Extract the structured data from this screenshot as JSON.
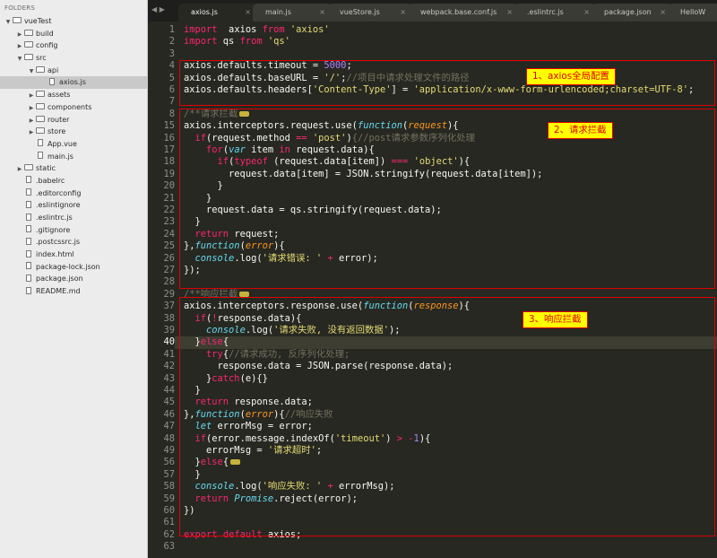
{
  "sidebar": {
    "title": "FOLDERS",
    "items": [
      {
        "name": "vueTest",
        "depth": 0,
        "type": "folder-open"
      },
      {
        "name": "build",
        "depth": 1,
        "type": "folder"
      },
      {
        "name": "config",
        "depth": 1,
        "type": "folder"
      },
      {
        "name": "src",
        "depth": 1,
        "type": "folder-open"
      },
      {
        "name": "api",
        "depth": 2,
        "type": "folder-open"
      },
      {
        "name": "axios.js",
        "depth": 3,
        "type": "file",
        "selected": true
      },
      {
        "name": "assets",
        "depth": 2,
        "type": "folder"
      },
      {
        "name": "components",
        "depth": 2,
        "type": "folder"
      },
      {
        "name": "router",
        "depth": 2,
        "type": "folder"
      },
      {
        "name": "store",
        "depth": 2,
        "type": "folder"
      },
      {
        "name": "App.vue",
        "depth": 2,
        "type": "file"
      },
      {
        "name": "main.js",
        "depth": 2,
        "type": "file"
      },
      {
        "name": "static",
        "depth": 1,
        "type": "folder"
      },
      {
        "name": ".babelrc",
        "depth": 1,
        "type": "file"
      },
      {
        "name": ".editorconfig",
        "depth": 1,
        "type": "file"
      },
      {
        "name": ".eslintignore",
        "depth": 1,
        "type": "file"
      },
      {
        "name": ".eslintrc.js",
        "depth": 1,
        "type": "file"
      },
      {
        "name": ".gitignore",
        "depth": 1,
        "type": "file"
      },
      {
        "name": ".postcssrc.js",
        "depth": 1,
        "type": "file"
      },
      {
        "name": "index.html",
        "depth": 1,
        "type": "file"
      },
      {
        "name": "package-lock.json",
        "depth": 1,
        "type": "file"
      },
      {
        "name": "package.json",
        "depth": 1,
        "type": "file"
      },
      {
        "name": "README.md",
        "depth": 1,
        "type": "file"
      }
    ]
  },
  "tabs": {
    "nav": "◀ ▶",
    "items": [
      {
        "label": "axios.js",
        "close": "×",
        "active": true
      },
      {
        "label": "main.js",
        "close": "×"
      },
      {
        "label": "vueStore.js",
        "close": "×"
      },
      {
        "label": "webpack.base.conf.js",
        "close": "×"
      },
      {
        "label": ".eslintrc.js",
        "close": "×"
      },
      {
        "label": "package.json",
        "close": "×"
      },
      {
        "label": "HelloW",
        "close": ""
      }
    ]
  },
  "editor": {
    "current_line": "40",
    "lines": [
      {
        "n": "1",
        "t": [
          [
            "k",
            "import"
          ],
          [
            "",
            "  axios "
          ],
          [
            "k",
            "from"
          ],
          [
            "",
            " "
          ],
          [
            "s",
            "'axios'"
          ]
        ]
      },
      {
        "n": "2",
        "t": [
          [
            "k",
            "import"
          ],
          [
            "",
            " qs "
          ],
          [
            "k",
            "from"
          ],
          [
            "",
            " "
          ],
          [
            "s",
            "'qs'"
          ]
        ]
      },
      {
        "n": "3",
        "t": []
      },
      {
        "n": "4",
        "t": [
          [
            "",
            "axios.defaults.timeout = "
          ],
          [
            "n",
            "5000"
          ],
          [
            "",
            ";"
          ]
        ]
      },
      {
        "n": "5",
        "t": [
          [
            "",
            "axios.defaults.baseURL = "
          ],
          [
            "s",
            "'/'"
          ],
          [
            "",
            ";"
          ],
          [
            "c",
            "//项目中请求处理文件的路径"
          ]
        ]
      },
      {
        "n": "6",
        "t": [
          [
            "",
            "axios.defaults.headers["
          ],
          [
            "s",
            "'Content-Type'"
          ],
          [
            "",
            "] = "
          ],
          [
            "s",
            "'application/x-www-form-urlencoded;charset=UTF-8'"
          ],
          [
            "",
            ";"
          ]
        ]
      },
      {
        "n": "7",
        "t": []
      },
      {
        "n": "8",
        "t": [
          [
            "c",
            "/**请求拦截"
          ]
        ],
        "fold": true
      },
      {
        "n": "15",
        "t": [
          [
            "",
            "axios.interceptors.request.use("
          ],
          [
            "it",
            "function"
          ],
          [
            "",
            "("
          ],
          [
            "p",
            "request"
          ],
          [
            "",
            "){"
          ]
        ]
      },
      {
        "n": "16",
        "t": [
          [
            "",
            "  "
          ],
          [
            "k",
            "if"
          ],
          [
            "",
            "(request.method "
          ],
          [
            "k",
            "=="
          ],
          [
            "",
            " "
          ],
          [
            "s",
            "'post'"
          ],
          [
            "",
            ")"
          ],
          [
            "c",
            "{//post请求参数序列化处理"
          ]
        ]
      },
      {
        "n": "17",
        "t": [
          [
            "",
            "    "
          ],
          [
            "k",
            "for"
          ],
          [
            "",
            "("
          ],
          [
            "it",
            "var"
          ],
          [
            "",
            " item "
          ],
          [
            "k",
            "in"
          ],
          [
            "",
            " request.data){"
          ]
        ]
      },
      {
        "n": "18",
        "t": [
          [
            "",
            "      "
          ],
          [
            "k",
            "if"
          ],
          [
            "",
            "("
          ],
          [
            "k",
            "typeof"
          ],
          [
            "",
            " (request.data[item]) "
          ],
          [
            "k",
            "==="
          ],
          [
            "",
            " "
          ],
          [
            "s",
            "'object'"
          ],
          [
            "",
            "){"
          ]
        ]
      },
      {
        "n": "19",
        "t": [
          [
            "",
            "        request.data[item] = JSON.stringify(request.data[item]);"
          ]
        ]
      },
      {
        "n": "20",
        "t": [
          [
            "",
            "      }"
          ]
        ]
      },
      {
        "n": "21",
        "t": [
          [
            "",
            "    }"
          ]
        ]
      },
      {
        "n": "22",
        "t": [
          [
            "",
            "    request.data = qs.stringify(request.data);"
          ]
        ]
      },
      {
        "n": "23",
        "t": [
          [
            "",
            "  }"
          ]
        ]
      },
      {
        "n": "24",
        "t": [
          [
            "",
            "  "
          ],
          [
            "k",
            "return"
          ],
          [
            "",
            " request;"
          ]
        ]
      },
      {
        "n": "25",
        "t": [
          [
            "",
            "},"
          ],
          [
            "it",
            "function"
          ],
          [
            "",
            "("
          ],
          [
            "p",
            "error"
          ],
          [
            "",
            "){"
          ]
        ]
      },
      {
        "n": "26",
        "t": [
          [
            "",
            "  "
          ],
          [
            "it",
            "console"
          ],
          [
            "",
            ".log("
          ],
          [
            "s",
            "'请求错误: '"
          ],
          [
            "",
            " "
          ],
          [
            "k",
            "+"
          ],
          [
            "",
            " error);"
          ]
        ]
      },
      {
        "n": "27",
        "t": [
          [
            "",
            "});"
          ]
        ]
      },
      {
        "n": "28",
        "t": []
      },
      {
        "n": "29",
        "t": [
          [
            "c",
            "/**响应拦截"
          ]
        ],
        "fold": true
      },
      {
        "n": "37",
        "t": [
          [
            "",
            "axios.interceptors.response.use("
          ],
          [
            "it",
            "function"
          ],
          [
            "",
            "("
          ],
          [
            "p",
            "response"
          ],
          [
            "",
            "){"
          ]
        ]
      },
      {
        "n": "38",
        "t": [
          [
            "",
            "  "
          ],
          [
            "k",
            "if"
          ],
          [
            "",
            "("
          ],
          [
            "k",
            "!"
          ],
          [
            "",
            "response.data){"
          ]
        ]
      },
      {
        "n": "39",
        "t": [
          [
            "",
            "    "
          ],
          [
            "it",
            "console"
          ],
          [
            "",
            ".log("
          ],
          [
            "s",
            "'请求失败, 没有返回数据'"
          ],
          [
            "",
            ");"
          ]
        ]
      },
      {
        "n": "40",
        "t": [
          [
            "",
            "  }"
          ],
          [
            "k",
            "else"
          ],
          [
            "",
            "{"
          ]
        ]
      },
      {
        "n": "41",
        "t": [
          [
            "",
            "    "
          ],
          [
            "k",
            "try"
          ],
          [
            "",
            "{"
          ],
          [
            "c",
            "//请求成功, 反序列化处理;"
          ]
        ]
      },
      {
        "n": "42",
        "t": [
          [
            "",
            "      response.data = JSON.parse(response.data);"
          ]
        ]
      },
      {
        "n": "43",
        "t": [
          [
            "",
            "    }"
          ],
          [
            "k",
            "catch"
          ],
          [
            "",
            "(e){}"
          ]
        ]
      },
      {
        "n": "44",
        "t": [
          [
            "",
            "  }"
          ]
        ]
      },
      {
        "n": "45",
        "t": [
          [
            "",
            "  "
          ],
          [
            "k",
            "return"
          ],
          [
            "",
            " response.data;"
          ]
        ]
      },
      {
        "n": "46",
        "t": [
          [
            "",
            "},"
          ],
          [
            "it",
            "function"
          ],
          [
            "",
            "("
          ],
          [
            "p",
            "error"
          ],
          [
            "",
            "){"
          ],
          [
            "c",
            "//响应失败"
          ]
        ]
      },
      {
        "n": "47",
        "t": [
          [
            "",
            "  "
          ],
          [
            "it",
            "let"
          ],
          [
            "",
            " errorMsg = error;"
          ]
        ]
      },
      {
        "n": "48",
        "t": [
          [
            "",
            "  "
          ],
          [
            "k",
            "if"
          ],
          [
            "",
            "(error.message.indexOf("
          ],
          [
            "s",
            "'timeout'"
          ],
          [
            "",
            ") "
          ],
          [
            "k",
            ">"
          ],
          [
            "",
            " "
          ],
          [
            "k",
            "-"
          ],
          [
            "n",
            "1"
          ],
          [
            "",
            "){"
          ]
        ]
      },
      {
        "n": "49",
        "t": [
          [
            "",
            "    errorMsg = "
          ],
          [
            "s",
            "'请求超时'"
          ],
          [
            "",
            ";"
          ]
        ]
      },
      {
        "n": "56",
        "t": [
          [
            "",
            "  }"
          ],
          [
            "k",
            "else"
          ],
          [
            "",
            "{"
          ]
        ],
        "fold": true
      },
      {
        "n": "57",
        "t": [
          [
            "",
            "  }"
          ]
        ]
      },
      {
        "n": "58",
        "t": [
          [
            "",
            "  "
          ],
          [
            "it",
            "console"
          ],
          [
            "",
            ".log("
          ],
          [
            "s",
            "'响应失败: '"
          ],
          [
            "",
            " "
          ],
          [
            "k",
            "+"
          ],
          [
            "",
            " errorMsg);"
          ]
        ]
      },
      {
        "n": "59",
        "t": [
          [
            "",
            "  "
          ],
          [
            "k",
            "return"
          ],
          [
            "",
            " "
          ],
          [
            "it",
            "Promise"
          ],
          [
            "",
            ".reject(error);"
          ]
        ]
      },
      {
        "n": "60",
        "t": [
          [
            "",
            "})"
          ]
        ]
      },
      {
        "n": "61",
        "t": []
      },
      {
        "n": "62",
        "t": [
          [
            "k",
            "export"
          ],
          [
            "",
            " "
          ],
          [
            "k",
            "default"
          ],
          [
            "",
            " axios;"
          ]
        ]
      },
      {
        "n": "63",
        "t": []
      }
    ]
  },
  "annotations": [
    {
      "label": "1、axios全局配置"
    },
    {
      "label": "2、请求拦截"
    },
    {
      "label": "3、响应拦截"
    }
  ],
  "colors": {
    "annotation_border": "#e00000",
    "annotation_fill": "#ffff00",
    "editor_bg": "#272822",
    "keyword": "#f92672",
    "string": "#e6db74",
    "number": "#ae81ff",
    "comment": "#75715e"
  }
}
